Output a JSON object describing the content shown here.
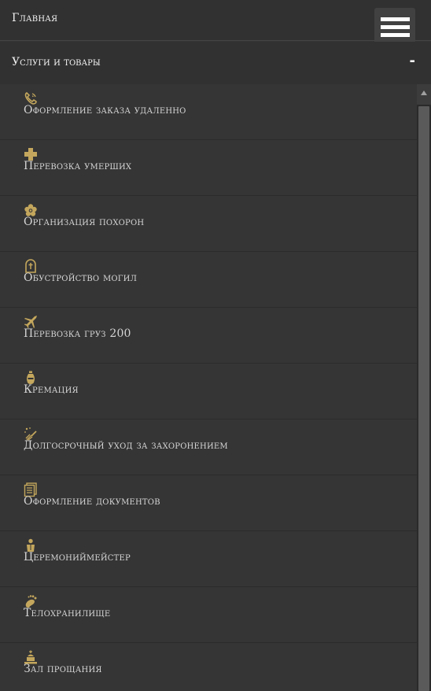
{
  "colors": {
    "background": "#353535",
    "header_bg": "#313131",
    "text": "#d6d6d6",
    "icon_gold": "#c4a75d"
  },
  "nav": {
    "home_label": "Главная",
    "section_label": "Услуги и товары",
    "collapse_symbol": "-"
  },
  "items": [
    {
      "label": "Оформление заказа удаленно",
      "icon": "phone-icon"
    },
    {
      "label": "Перевозка умерших",
      "icon": "cross-icon"
    },
    {
      "label": "Организация похорон",
      "icon": "flower-icon"
    },
    {
      "label": "Обустройство могил",
      "icon": "gravestone-icon"
    },
    {
      "label": "Перевозка груз 200",
      "icon": "airplane-icon"
    },
    {
      "label": "Кремация",
      "icon": "urn-icon"
    },
    {
      "label": "Долгосрочный уход за захоронением",
      "icon": "cleaning-icon"
    },
    {
      "label": "Оформление документов",
      "icon": "documents-icon"
    },
    {
      "label": "Церемониймейстер",
      "icon": "person-icon"
    },
    {
      "label": "Телохранилище",
      "icon": "footprint-icon"
    },
    {
      "label": "Зал прощания",
      "icon": "hall-icon"
    }
  ]
}
